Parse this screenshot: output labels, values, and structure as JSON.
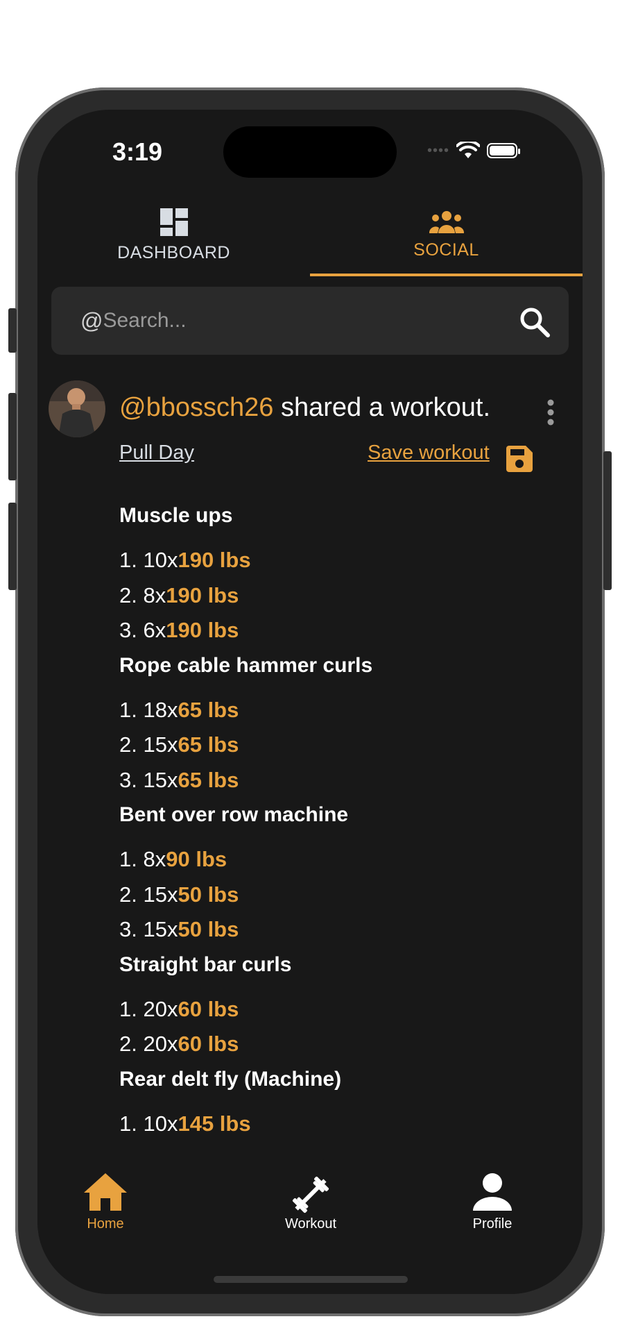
{
  "status_bar": {
    "time": "3:19"
  },
  "tabs": [
    {
      "label": "DASHBOARD",
      "icon": "dashboard-icon",
      "active": false
    },
    {
      "label": "SOCIAL",
      "icon": "group-icon",
      "active": true
    }
  ],
  "search": {
    "prefix": "@",
    "placeholder": "Search...",
    "value": ""
  },
  "post": {
    "username": "@bbossch26",
    "action": " shared a workout.",
    "workout_name": "Pull Day",
    "save_label": "Save workout",
    "exercises": [
      {
        "name": "Muscle ups",
        "sets": [
          {
            "num": "1.",
            "reps": "10x",
            "weight": "190 lbs"
          },
          {
            "num": "2.",
            "reps": "8x",
            "weight": "190 lbs"
          },
          {
            "num": "3.",
            "reps": "6x",
            "weight": "190 lbs"
          }
        ]
      },
      {
        "name": "Rope cable hammer curls",
        "sets": [
          {
            "num": "1.",
            "reps": "18x",
            "weight": "65 lbs"
          },
          {
            "num": "2.",
            "reps": "15x",
            "weight": "65 lbs"
          },
          {
            "num": "3.",
            "reps": "15x",
            "weight": "65 lbs"
          }
        ]
      },
      {
        "name": "Bent over row machine",
        "sets": [
          {
            "num": "1.",
            "reps": "8x",
            "weight": "90 lbs"
          },
          {
            "num": "2.",
            "reps": "15x",
            "weight": "50 lbs"
          },
          {
            "num": "3.",
            "reps": "15x",
            "weight": "50 lbs"
          }
        ]
      },
      {
        "name": "Straight bar curls",
        "sets": [
          {
            "num": "1.",
            "reps": "20x",
            "weight": "60 lbs"
          },
          {
            "num": "2.",
            "reps": "20x",
            "weight": "60 lbs"
          }
        ]
      },
      {
        "name": "Rear delt fly (Machine)",
        "sets": [
          {
            "num": "1.",
            "reps": "10x",
            "weight": "145 lbs"
          }
        ]
      }
    ]
  },
  "bottom_nav": [
    {
      "label": "Home",
      "icon": "home-icon",
      "active": true
    },
    {
      "label": "Workout",
      "icon": "dumbbell-icon",
      "active": false
    },
    {
      "label": "Profile",
      "icon": "person-icon",
      "active": false
    }
  ],
  "colors": {
    "accent": "#e8a23f",
    "background": "#181818",
    "surface": "#2a2a2a",
    "text": "#ffffff"
  }
}
